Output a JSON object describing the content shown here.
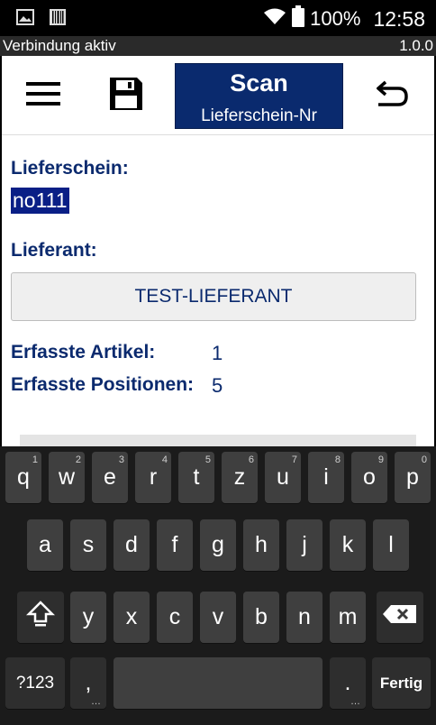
{
  "status": {
    "battery": "100%",
    "time": "12:58"
  },
  "connection": {
    "status": "Verbindung aktiv",
    "version": "1.0.0"
  },
  "toolbar": {
    "scan_title": "Scan",
    "scan_subtitle": "Lieferschein-Nr"
  },
  "form": {
    "lieferschein_label": "Lieferschein:",
    "lieferschein_value": "no111",
    "lieferant_label": "Lieferant:",
    "lieferant_value": "TEST-LIEFERANT",
    "artikel_label": "Erfasste Artikel:",
    "artikel_value": "1",
    "positionen_label": "Erfasste Positionen:",
    "positionen_value": "5"
  },
  "keyboard": {
    "row1": [
      {
        "k": "q",
        "h": "1"
      },
      {
        "k": "w",
        "h": "2"
      },
      {
        "k": "e",
        "h": "3"
      },
      {
        "k": "r",
        "h": "4"
      },
      {
        "k": "t",
        "h": "5"
      },
      {
        "k": "z",
        "h": "6"
      },
      {
        "k": "u",
        "h": "7"
      },
      {
        "k": "i",
        "h": "8"
      },
      {
        "k": "o",
        "h": "9"
      },
      {
        "k": "p",
        "h": "0"
      }
    ],
    "row2": [
      "a",
      "s",
      "d",
      "f",
      "g",
      "h",
      "j",
      "k",
      "l"
    ],
    "row3": [
      "y",
      "x",
      "c",
      "v",
      "b",
      "n",
      "m"
    ],
    "symbols_label": "?123",
    "comma_label": ",",
    "period_label": ".",
    "done_label": "Fertig"
  }
}
